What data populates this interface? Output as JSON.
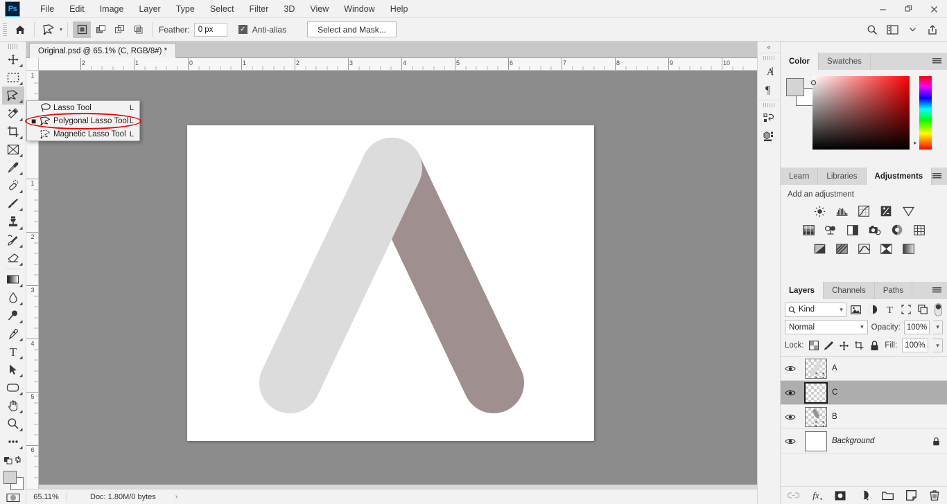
{
  "app": {
    "logo": "Ps"
  },
  "menubar": {
    "items": [
      {
        "label": "File"
      },
      {
        "label": "Edit"
      },
      {
        "label": "Image"
      },
      {
        "label": "Layer"
      },
      {
        "label": "Type"
      },
      {
        "label": "Select"
      },
      {
        "label": "Filter"
      },
      {
        "label": "3D"
      },
      {
        "label": "View"
      },
      {
        "label": "Window"
      },
      {
        "label": "Help"
      }
    ],
    "window_controls": [
      {
        "name": "minimize",
        "glyph": "—"
      },
      {
        "name": "restore",
        "glyph": "❐"
      },
      {
        "name": "close",
        "glyph": "✕"
      }
    ]
  },
  "optionsbar": {
    "home_icon": "home-icon",
    "tool_icon": "polygonal-lasso-icon",
    "selection_modes": [
      {
        "name": "new-selection",
        "active": true
      },
      {
        "name": "add-to-selection",
        "active": false
      },
      {
        "name": "subtract-from-selection",
        "active": false
      },
      {
        "name": "intersect-with-selection",
        "active": false
      }
    ],
    "feather_label": "Feather:",
    "feather_value": "0 px",
    "antialias_label": "Anti-alias",
    "antialias_checked": true,
    "select_and_mask_label": "Select and Mask...",
    "right_icons": [
      "search-icon",
      "workspace-icon",
      "chevron-down-icon",
      "share-icon"
    ]
  },
  "toolbar": {
    "tools": [
      {
        "name": "move-tool",
        "active": false
      },
      {
        "name": "rectangular-marquee-tool",
        "active": false
      },
      {
        "name": "lasso-tool",
        "active": true
      },
      {
        "name": "magic-wand-tool",
        "active": false
      },
      {
        "name": "crop-tool",
        "active": false
      },
      {
        "name": "frame-tool",
        "active": false
      },
      {
        "name": "eyedropper-tool",
        "active": false
      },
      {
        "name": "healing-brush-tool",
        "active": false
      },
      {
        "name": "brush-tool",
        "active": false
      },
      {
        "name": "clone-stamp-tool",
        "active": false
      },
      {
        "name": "history-brush-tool",
        "active": false
      },
      {
        "name": "eraser-tool",
        "active": false
      },
      {
        "name": "gradient-tool",
        "active": false
      },
      {
        "name": "blur-tool",
        "active": false
      },
      {
        "name": "dodge-tool",
        "active": false
      },
      {
        "name": "pen-tool",
        "active": false
      },
      {
        "name": "type-tool",
        "active": false
      },
      {
        "name": "path-selection-tool",
        "active": false
      },
      {
        "name": "rectangle-tool",
        "active": false
      },
      {
        "name": "hand-tool",
        "active": false
      },
      {
        "name": "zoom-tool",
        "active": false
      },
      {
        "name": "edit-toolbar-tool",
        "active": false
      }
    ],
    "foreground_color": "#d4d4d4",
    "background_color": "#ffffff"
  },
  "flyout": {
    "items": [
      {
        "label": "Lasso Tool",
        "shortcut": "L",
        "icon": "lasso-icon",
        "selected": false
      },
      {
        "label": "Polygonal Lasso Tool",
        "shortcut": "L",
        "icon": "polygonal-lasso-icon",
        "selected": true
      },
      {
        "label": "Magnetic Lasso Tool",
        "shortcut": "L",
        "icon": "magnetic-lasso-icon",
        "selected": false
      }
    ],
    "annotation_color": "#ee0000"
  },
  "document": {
    "tab_title": "Original.psd @ 65.1% (C, RGB/8#) *"
  },
  "rulers": {
    "horizontal_ticks": [
      "2",
      "1",
      "0",
      "1",
      "2",
      "3",
      "4",
      "5",
      "6",
      "7",
      "8",
      "9",
      "10"
    ],
    "vertical_ticks": [
      "1",
      "1",
      "2",
      "3",
      "4",
      "5",
      "6"
    ]
  },
  "artwork": {
    "left_stroke_color": "#dcdcdc",
    "right_stroke_color": "#a08f8f",
    "canvas_color": "#ffffff"
  },
  "statusbar": {
    "zoom": "65.11%",
    "doc_info": "Doc: 1.80M/0 bytes",
    "arrow": "›"
  },
  "dockstrip": {
    "collapse_glyph": "«",
    "buttons": [
      {
        "name": "character-panel-icon",
        "glyph": "A"
      },
      {
        "name": "paragraph-panel-icon",
        "glyph": "¶"
      },
      {
        "name": "history-panel-icon",
        "glyph": ""
      },
      {
        "name": "3d-panel-icon",
        "glyph": ""
      }
    ]
  },
  "color_panel": {
    "tabs": [
      {
        "label": "Color",
        "active": true
      },
      {
        "label": "Swatches",
        "active": false
      }
    ],
    "foreground_color": "#d4d4d4",
    "background_color": "#ffffff",
    "field_hue": "#ff0000"
  },
  "adjustments_panel": {
    "tabs": [
      {
        "label": "Learn",
        "active": false
      },
      {
        "label": "Libraries",
        "active": false
      },
      {
        "label": "Adjustments",
        "active": true
      }
    ],
    "title": "Add an adjustment",
    "row1": [
      "brightness-contrast-icon",
      "levels-icon",
      "curves-icon",
      "exposure-icon",
      "vibrance-icon"
    ],
    "row2": [
      "hue-saturation-icon",
      "color-balance-icon",
      "black-white-icon",
      "photo-filter-icon",
      "channel-mixer-icon",
      "color-lookup-icon"
    ],
    "row3": [
      "invert-icon",
      "posterize-icon",
      "threshold-icon",
      "gradient-map-icon",
      "selective-color-icon"
    ]
  },
  "layers_panel": {
    "tabs": [
      {
        "label": "Layers",
        "active": true
      },
      {
        "label": "Channels",
        "active": false
      },
      {
        "label": "Paths",
        "active": false
      }
    ],
    "filter_kind": "Kind",
    "filter_icons": [
      "pixel-filter-icon",
      "adjustment-filter-icon",
      "type-filter-icon",
      "shape-filter-icon",
      "smart-object-filter-icon"
    ],
    "blend_mode": "Normal",
    "opacity_label": "Opacity:",
    "opacity_value": "100%",
    "lock_label": "Lock:",
    "lock_icons": [
      "lock-transparency-icon",
      "lock-image-icon",
      "lock-position-icon",
      "lock-artboard-icon",
      "lock-all-icon"
    ],
    "fill_label": "Fill:",
    "fill_value": "100%",
    "layers": [
      {
        "name": "A",
        "visible": true,
        "selected": false,
        "italic": false,
        "locked": false,
        "thumb": "transparent"
      },
      {
        "name": "C",
        "visible": true,
        "selected": true,
        "italic": false,
        "locked": false,
        "thumb": "transparent"
      },
      {
        "name": "B",
        "visible": true,
        "selected": false,
        "italic": false,
        "locked": false,
        "thumb": "transparent"
      },
      {
        "name": "Background",
        "visible": true,
        "selected": false,
        "italic": true,
        "locked": true,
        "thumb": "white"
      }
    ],
    "bottom_icons": [
      "link-layers-icon",
      "add-layer-style-icon",
      "add-layer-mask-icon",
      "new-fill-adjustment-icon",
      "new-group-icon",
      "new-layer-icon",
      "delete-layer-icon"
    ]
  }
}
